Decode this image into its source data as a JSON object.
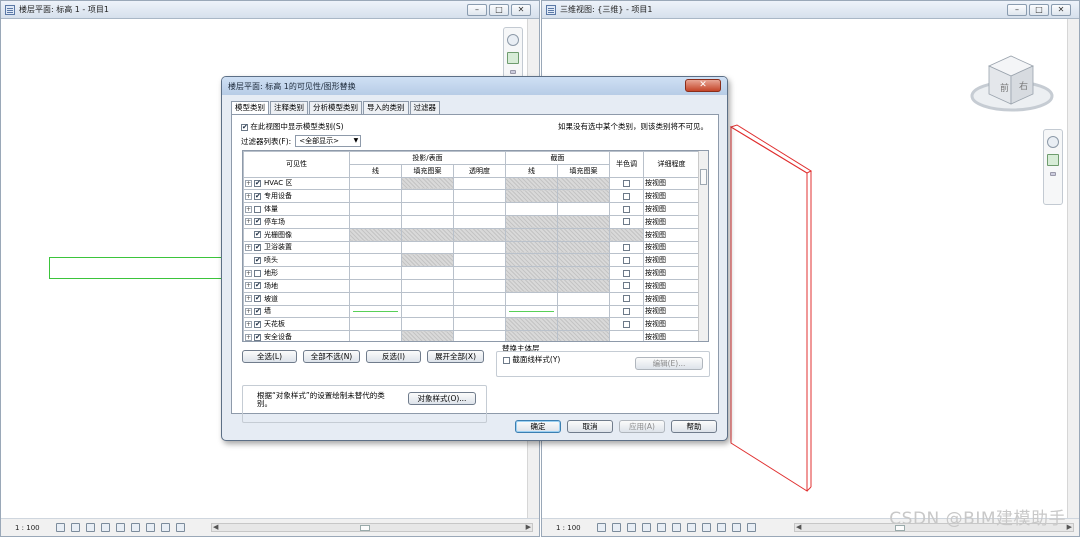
{
  "left_view": {
    "title": "楼层平面: 标高 1 - 项目1",
    "controls": [
      "–",
      "□",
      "✕"
    ],
    "scale": "1 : 100"
  },
  "right_view": {
    "title": "三维视图: {三维} - 项目1",
    "controls": [
      "–",
      "□",
      "✕"
    ],
    "scale": "1 : 100",
    "viewcube": {
      "front": "前",
      "right": "右"
    }
  },
  "dialog": {
    "title": "楼层平面: 标高 1的可见性/图形替换",
    "close": "✕",
    "tabs": [
      "模型类别",
      "注释类别",
      "分析模型类别",
      "导入的类别",
      "过滤器"
    ],
    "show_categories_label": "在此视图中显示模型类别(S)",
    "note": "如果没有选中某个类别，则该类别将不可见。",
    "filter_label": "过滤器列表(F):",
    "filter_value": "<全部显示>",
    "headers": {
      "visibility": "可见性",
      "projection_surface": "投影/表面",
      "cut": "截面",
      "line": "线",
      "fill_pattern": "填充图案",
      "transparency": "透明度",
      "halftone": "半色调",
      "detail_level": "详细程度"
    },
    "rows": [
      {
        "name": "HVAC 区",
        "expander": "+",
        "checked": true,
        "halftone": true,
        "detail": "按视图"
      },
      {
        "name": "专用设备",
        "expander": "+",
        "checked": true,
        "halftone": true,
        "detail": "按视图"
      },
      {
        "name": "体量",
        "expander": "+",
        "checked": false,
        "halftone": true,
        "detail": "按视图"
      },
      {
        "name": "停车场",
        "expander": "+",
        "checked": true,
        "halftone": true,
        "detail": "按视图"
      },
      {
        "name": "光栅图像",
        "expander": "",
        "checked": true,
        "halftone": false,
        "detail": "按视图"
      },
      {
        "name": "卫浴装置",
        "expander": "+",
        "checked": true,
        "halftone": true,
        "detail": "按视图"
      },
      {
        "name": "喷头",
        "expander": "",
        "checked": true,
        "halftone": true,
        "detail": "按视图"
      },
      {
        "name": "地形",
        "expander": "+",
        "checked": false,
        "halftone": true,
        "detail": "按视图"
      },
      {
        "name": "场地",
        "expander": "+",
        "checked": true,
        "halftone": true,
        "detail": "按视图"
      },
      {
        "name": "坡道",
        "expander": "+",
        "checked": true,
        "halftone": true,
        "detail": "按视图"
      },
      {
        "name": "墙",
        "expander": "+",
        "checked": true,
        "halftone": true,
        "detail": "按视图"
      },
      {
        "name": "天花板",
        "expander": "+",
        "checked": true,
        "halftone": true,
        "detail": "按视图"
      },
      {
        "name": "安全设备",
        "expander": "+",
        "checked": true,
        "halftone": false,
        "detail": "按视图"
      }
    ],
    "buttons": {
      "select_all": "全选(L)",
      "select_none": "全部不选(N)",
      "invert": "反选(I)",
      "expand_all": "展开全部(X)",
      "edit": "编辑(E)...",
      "object_styles": "对象样式(O)...",
      "ok": "确定",
      "cancel": "取消",
      "apply": "应用(A)",
      "help": "帮助"
    },
    "override_host": "替换主体层",
    "cut_line_styles": "截面线样式(Y)",
    "object_style_note": "根据“对象样式”的设置绘制未替代的类别。"
  },
  "watermark": "CSDN @BIM建模助手"
}
